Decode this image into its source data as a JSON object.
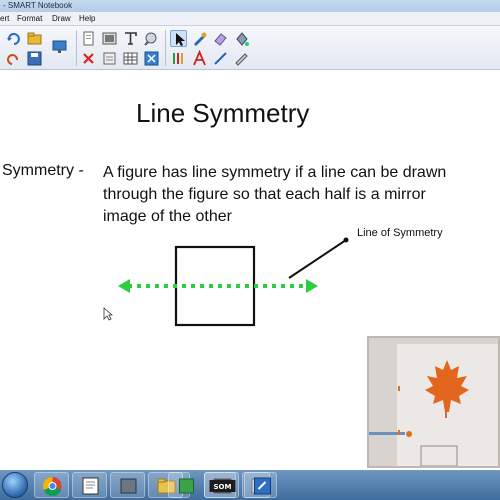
{
  "window": {
    "title": "- SMART Notebook"
  },
  "menu": {
    "items": [
      "ert",
      "Format",
      "Draw",
      "Help"
    ]
  },
  "toolbar": {
    "buttons": [
      "redo",
      "open-file",
      "screen-shade",
      "add-page",
      "table",
      "capture",
      "select",
      "pen",
      "eraser",
      "fill",
      "delete",
      "save",
      "properties",
      "full-screen",
      "creative-pen",
      "text",
      "line",
      "shape"
    ]
  },
  "slide": {
    "title": "Line Symmetry",
    "term": "Symmetry -",
    "definition_lines": [
      "A figure has line symmetry if a line can be drawn",
      "through the figure so that each half is a mirror",
      "image of the other"
    ],
    "annotation": "Line of Symmetry"
  },
  "colors": {
    "symmetry_line": "#2ecc40",
    "taskbar": "#4a78a8",
    "titlebar": "#c6d9ee"
  },
  "taskbar": {
    "apps": [
      "start-orb",
      "chrome",
      "notebook",
      "folder",
      "app-green",
      "app-black",
      "app-gray",
      "som",
      "smart-app"
    ]
  }
}
